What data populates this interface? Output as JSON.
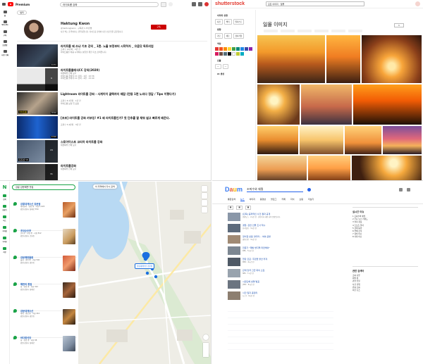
{
  "youtube": {
    "brand": "Premium",
    "search_query": "라이트룸 강좌",
    "sidebar": [
      "홈",
      "Shorts",
      "구독",
      "보관함",
      "시청 기록"
    ],
    "filter_label": "필터",
    "channel": {
      "name": "Haktung Kwon",
      "handle": "@haktungkwon · 구독자 1.37만명",
      "desc": "사진 찍는 걸 좋아하는 권학퉁입니다. 라이트룸 강좌와 사진 보정 팁을 공유합니다.",
      "subscribe": "구독"
    },
    "videos": [
      {
        "title": "라이트룸 왜 쓰냐 기초 강의 _ 1편. 노출 보정부터 시작하자 _ 으음닷 독트리엄",
        "meta": "조회수 12만회 · 2년 전\n라이트룸을 처음 시작하는 분들을 위한 기초 강의입니다.",
        "badge": "24:31"
      },
      {
        "title": "라이트룸클래식CC 강의(2020)",
        "meta": "재생목록 전체 보기\n라이트룸 클래식 CC 강의 - 1편 · 10:36\n라이트룸 클래식 CC 강의 - 2편 · 15:40",
        "badge": "9"
      },
      {
        "title": "Lightroom 라이트룸 강좌 - 사계이이 골택까지 때잡 (전동 1편 노리다 정답 / Tips 이렇다기)",
        "meta": "조회수 8.1천회 · 1년 전\n라이트룸 보정 팁 모음",
        "badge": "18:02"
      },
      {
        "title": "[초보] 라이트룸 강좌 카부잉! #1 왜 라이트룸인가? 첫 단추를 잘 채워 쉽고 빠르게 배운다.",
        "meta": "조회수 5.4만회 · 3년 전",
        "badge": "13:20"
      },
      {
        "title": "스토어이스프 코리아 라이트룸 강좌",
        "meta": "재생목록 전체 보기",
        "badge": "24"
      },
      {
        "title": "라이트룸강좌",
        "meta": "재생목록 전체 보기",
        "badge": "31"
      }
    ]
  },
  "shutterstock": {
    "logo": "shutterstock",
    "search_value": "일몰",
    "category": "모든 이미지",
    "page_title": "일몰 이미지",
    "page_label": "1",
    "sidebar_sections": [
      "이미지 유형",
      "방향",
      "색상",
      "인물",
      "AI 생성"
    ],
    "chips": [
      "사진",
      "벡터",
      "일러스트",
      "가로",
      "세로",
      "정사각형"
    ],
    "swatches": [
      "#e53935",
      "#f4511e",
      "#fb8c00",
      "#fdd835",
      "#43a047",
      "#00897b",
      "#1e88e5",
      "#3949ab",
      "#8e24aa",
      "#d81b60",
      "#6d4c41",
      "#546e7a",
      "#111111",
      "#ffffff",
      "#c0ca33",
      "#00acc1"
    ]
  },
  "naver_map": {
    "search_value": "강릉 강문해변 맛집",
    "rail": [
      "검색",
      "길찾기",
      "버스",
      "지하철",
      "거리뷰",
      "저장"
    ],
    "places": [
      {
        "name": "강릉대게수산 강문점",
        "info": "대게요리 · 영업 중 · 리뷰 1,024\n강원 강릉시 창해로 350"
      },
      {
        "name": "초당순두부",
        "info": "순두부 · 영업 중 · 리뷰 812\n강원 강릉시 초당동"
      },
      {
        "name": "강문해변물회",
        "info": "물회 · 영업 중 · 리뷰 540\n강원 강릉시 강문동"
      },
      {
        "name": "해변의 횟집",
        "info": "회 · 영업 중 · 리뷰 322\n강원 강릉시 창해로"
      },
      {
        "name": "강문대게수산",
        "info": "대게 · 영업 중 · 리뷰 210\n강원 강릉시 강문동"
      },
      {
        "name": "바다회식당",
        "info": "회 · 영업 중 · 리뷰 98\n강원 강릉시 창해로"
      }
    ],
    "map_pin_label": "강릉대게수산 강문점",
    "map_notice": "이 지역에서 다시 검색"
  },
  "daum": {
    "logo": "Daum",
    "search_value": "조퇴수와 쉐필",
    "tabs": [
      "통합검색",
      "뉴스",
      "이미지",
      "동영상",
      "블로그",
      "카페",
      "지식",
      "쇼핑",
      "더보기"
    ],
    "news": [
      {
        "title": "[단독] 충격적인 사건 결과 공개",
        "meta": "연합뉴스 · 2시간 전 · 관련기사 내용 요약 문장입니다."
      },
      {
        "title": "경찰, 관련 인물 조사 착수",
        "meta": "한국일보 · 3시간 전"
      },
      {
        "title": "정치권 반응 잇따라… 여야 공방",
        "meta": "경향신문 · 4시간 전"
      },
      {
        "title": "전문가 \"재발 방지책 마련해야\"",
        "meta": "KBS · 5시간 전"
      },
      {
        "title": "현장 르포: 주민들 불안 커져",
        "meta": "MBC · 6시간 전"
      },
      {
        "title": "관계 당국 긴급 회의 소집",
        "meta": "SBS · 7시간 전"
      },
      {
        "title": "시민단체 성명 발표",
        "meta": "JTBC · 8시간 전"
      },
      {
        "title": "사건 일지 총정리",
        "meta": "뉴스1 · 9시간 전"
      }
    ],
    "right_box1": {
      "title": "실시간 이슈",
      "rows": [
        "1 조퇴수와 쉐필",
        "2 주요 뉴스 키워드",
        "3 날씨 정보",
        "4 스포츠 결과",
        "5 경제 동향",
        "6 연예 소식",
        "7 정치 이슈",
        "8 사회 이슈"
      ]
    },
    "right_box2": {
      "title": "관련 검색어",
      "rows": [
        "조퇴 사유",
        "쉐필 뜻",
        "관련 인물",
        "사건 경위",
        "반응 모음",
        "최신 뉴스"
      ]
    }
  }
}
